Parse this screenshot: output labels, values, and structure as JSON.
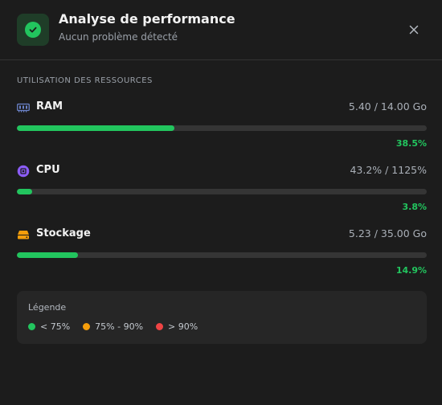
{
  "header": {
    "title": "Analyse de performance",
    "subtitle": "Aucun problème détecté",
    "status_icon": "check-circle-icon",
    "close_icon": "close-icon"
  },
  "section": {
    "title": "UTILISATION DES RESSOURCES"
  },
  "resources": [
    {
      "name": "RAM",
      "value": "5.40 / 14.00 Go",
      "percent_label": "38.5%",
      "fraction": 0.385,
      "icon": "ram-icon",
      "icon_color": "#6b83c9"
    },
    {
      "name": "CPU",
      "value": "43.2% / 1125%",
      "percent_label": "3.8%",
      "fraction": 0.038,
      "icon": "cpu-icon",
      "icon_color": "#8b5cf6"
    },
    {
      "name": "Stockage",
      "value": "5.23 / 35.00 Go",
      "percent_label": "14.9%",
      "fraction": 0.149,
      "icon": "storage-icon",
      "icon_color": "#f59e0b"
    }
  ],
  "legend": {
    "title": "Légende",
    "items": [
      {
        "label": "< 75%",
        "color": "#22c55e"
      },
      {
        "label": "75% - 90%",
        "color": "#f59e0b"
      },
      {
        "label": "> 90%",
        "color": "#ef4444"
      }
    ]
  },
  "colors": {
    "ok": "#22c55e",
    "warning": "#f59e0b",
    "danger": "#ef4444"
  }
}
